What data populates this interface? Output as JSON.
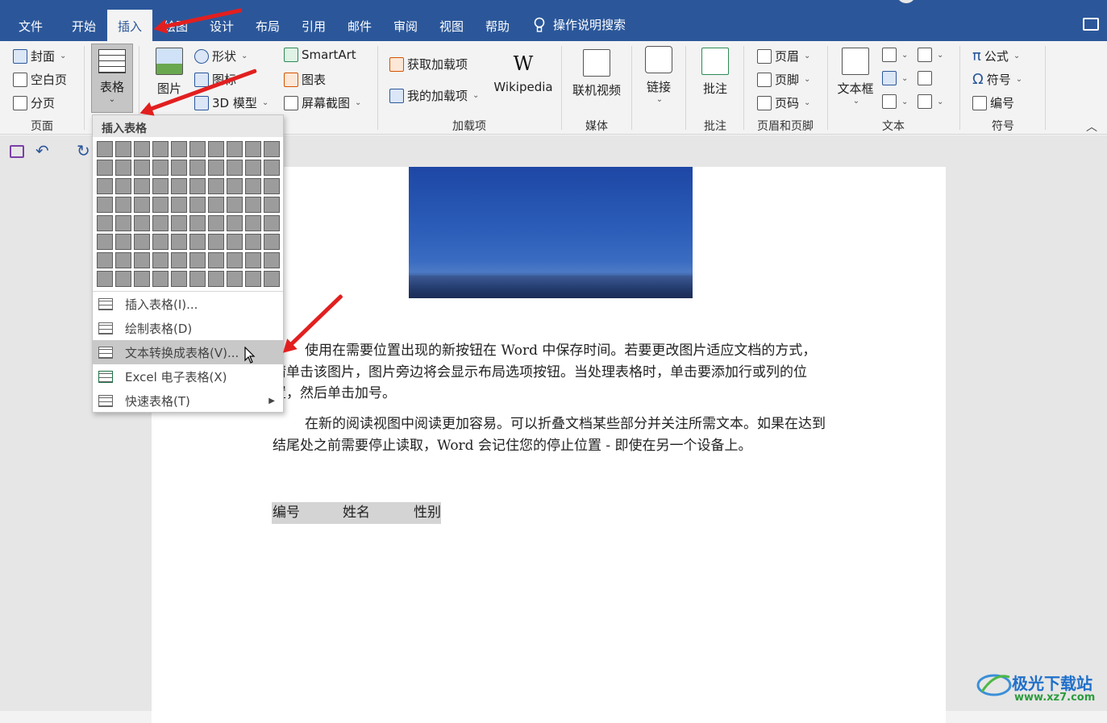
{
  "menu": {
    "tabs": [
      "文件",
      "开始",
      "插入",
      "绘图",
      "设计",
      "布局",
      "引用",
      "邮件",
      "审阅",
      "视图",
      "帮助"
    ],
    "active": "插入",
    "search_label": "操作说明搜索"
  },
  "ribbon": {
    "pages": {
      "cover": "封面",
      "blank_page": "空白页",
      "page_break": "分页",
      "group": "页面"
    },
    "table": {
      "label": "表格"
    },
    "illustrations": {
      "picture": "图片",
      "shapes": "形状",
      "icons": "图标",
      "model3d": "3D 模型",
      "smartart": "SmartArt",
      "chart": "图表",
      "screenshot": "屏幕截图"
    },
    "addins": {
      "get": "获取加载项",
      "mine": "我的加载项",
      "wikipedia": "Wikipedia",
      "group": "加载项"
    },
    "media": {
      "online_video": "联机视频",
      "group": "媒体"
    },
    "links": {
      "link": "链接"
    },
    "comments": {
      "comment": "批注",
      "group": "批注"
    },
    "header_footer": {
      "header": "页眉",
      "footer": "页脚",
      "page_number": "页码",
      "group": "页眉和页脚"
    },
    "text": {
      "textbox": "文本框",
      "group": "文本"
    },
    "symbols": {
      "equation": "公式",
      "symbol": "符号",
      "numbering": "编号",
      "group": "符号"
    }
  },
  "dropdown": {
    "header": "插入表格",
    "grid_cols": 10,
    "grid_rows": 8,
    "items": [
      {
        "label": "插入表格(I)...",
        "highlight": false,
        "submenu": false
      },
      {
        "label": "绘制表格(D)",
        "highlight": false,
        "submenu": false
      },
      {
        "label": "文本转换成表格(V)...",
        "highlight": true,
        "submenu": false
      },
      {
        "label": "Excel 电子表格(X)",
        "highlight": false,
        "submenu": false
      },
      {
        "label": "快速表格(T)",
        "highlight": false,
        "submenu": true
      }
    ]
  },
  "document": {
    "para1": "使用在需要位置出现的新按钮在 Word 中保存时间。若要更改图片适应文档的方式，请单击该图片，图片旁边将会显示布局选项按钮。当处理表格时，单击要添加行或列的位置，然后单击加号。",
    "para2": "在新的阅读视图中阅读更加容易。可以折叠文档某些部分并关注所需文本。如果在达到结尾处之前需要停止读取，Word 会记住您的停止位置 - 即使在另一个设备上。",
    "table_headers": [
      "编号",
      "姓名",
      "性别"
    ]
  },
  "watermark": {
    "name": "极光下载站",
    "url": "www.xz7.com"
  }
}
